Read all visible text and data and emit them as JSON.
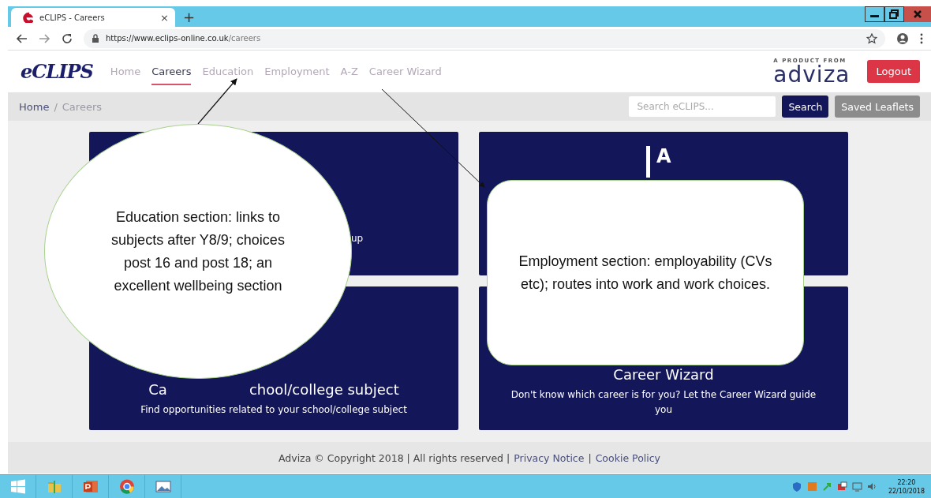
{
  "browser": {
    "tab_title": "eCLIPS - Careers",
    "tab_close": "×",
    "new_tab": "+",
    "url_host": "https://www.eclips-online.co.uk",
    "url_path": "/careers"
  },
  "header": {
    "logo": "eCLIPS",
    "nav": [
      {
        "label": "Home",
        "selected": false
      },
      {
        "label": "Careers",
        "selected": true
      },
      {
        "label": "Education",
        "selected": false
      },
      {
        "label": "Employment",
        "selected": false
      },
      {
        "label": "A-Z",
        "selected": false
      },
      {
        "label": "Career Wizard",
        "selected": false
      }
    ],
    "product_from": "A PRODUCT FROM",
    "brand": "adviza",
    "logout": "Logout"
  },
  "breadcrumb": {
    "items": [
      "Home",
      "Careers"
    ],
    "separator": "/"
  },
  "search": {
    "placeholder": "Search eCLIPS...",
    "button": "Search"
  },
  "saved_leaflets": "Saved Leaflets",
  "cards": [
    {
      "kind": "fragment",
      "text": "up"
    },
    {
      "kind": "az-icon",
      "letter": "A"
    },
    {
      "kind": "titled",
      "title_parts": [
        "Ca",
        "chool/college subject"
      ],
      "description": "Find opportunities related to your school/college subject"
    },
    {
      "kind": "titled",
      "title_parts": [
        "Career Wizard"
      ],
      "description": "Don't know which career is for you? Let the Career Wizard guide you"
    }
  ],
  "callouts": [
    {
      "kind": "ellipse",
      "text": "Education section: links to subjects after Y8/9; choices post 16 and post 18; an excellent wellbeing section"
    },
    {
      "kind": "rounded-rect",
      "text": "Employment section: employability (CVs etc); routes into work and work choices."
    }
  ],
  "footer": {
    "copyright": "Adviza © Copyright 2018 | All rights reserved |",
    "links": [
      "Privacy Notice",
      "Cookie Policy"
    ],
    "separator": "|"
  },
  "taskbar": {
    "time": "22:20",
    "date": "22/10/2018"
  }
}
